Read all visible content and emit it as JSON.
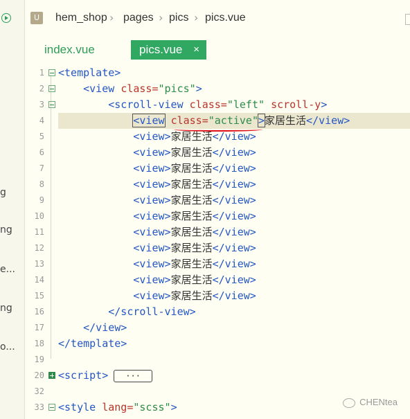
{
  "breadcrumb": {
    "icon": "U",
    "items": [
      "hem_shop",
      "pages",
      "pics",
      "pics.vue"
    ]
  },
  "left_fragments": [
    "g",
    "ng",
    "e...",
    "ng",
    "o..."
  ],
  "tabs": [
    {
      "label": "index.vue",
      "active": false
    },
    {
      "label": "pics.vue",
      "active": true,
      "close": "×"
    }
  ],
  "code": {
    "lines": [
      {
        "n": "1"
      },
      {
        "n": "2"
      },
      {
        "n": "3"
      },
      {
        "n": "4"
      },
      {
        "n": "5"
      },
      {
        "n": "6"
      },
      {
        "n": "7"
      },
      {
        "n": "8"
      },
      {
        "n": "9"
      },
      {
        "n": "10"
      },
      {
        "n": "11"
      },
      {
        "n": "12"
      },
      {
        "n": "13"
      },
      {
        "n": "14"
      },
      {
        "n": "15"
      },
      {
        "n": "16"
      },
      {
        "n": "17"
      },
      {
        "n": "18"
      },
      {
        "n": "19"
      },
      {
        "n": "20"
      },
      {
        "n": "32"
      },
      {
        "n": "33"
      }
    ],
    "item_text": "家居生活",
    "collapsed_label": "···"
  },
  "watermark": "CHENtea"
}
